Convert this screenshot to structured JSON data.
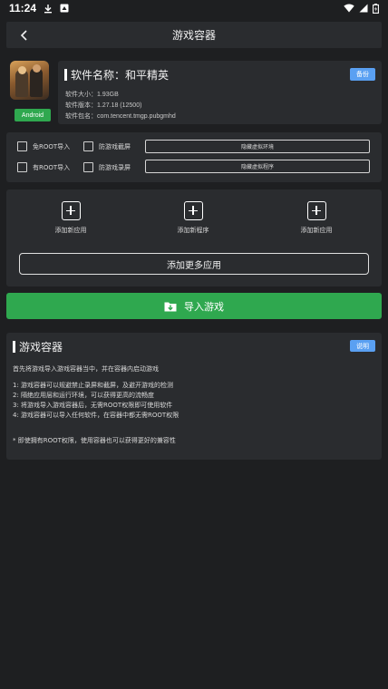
{
  "status": {
    "time": "11:24",
    "left_icons": [
      "download-icon",
      "notification-box-icon"
    ],
    "right_icons": [
      "wifi-icon",
      "signal-icon",
      "battery-icon"
    ]
  },
  "header": {
    "title": "游戏容器",
    "back_icon": "chevron-left-icon"
  },
  "app": {
    "platform": "Android",
    "name": "软件名称：和平精英",
    "backup_label": "备份",
    "size": "软件大小：1.93GB",
    "version": "软件版本：1.27.18 (12500)",
    "package": "软件包名：com.tencent.tmgp.pubgmhd"
  },
  "options": {
    "noroot_import": "免ROOT导入",
    "root_import": "有ROOT导入",
    "anti_screenshot": "防游戏截屏",
    "anti_record": "防游戏录屏",
    "btn1": "隐藏虚拟环境",
    "btn2": "隐藏虚拟程序"
  },
  "add": {
    "items": [
      "添加新应用",
      "添加新程序",
      "添加新应用"
    ],
    "more_label": "添加更多应用"
  },
  "import": {
    "label": "导入游戏",
    "icon": "folder-import-icon"
  },
  "desc": {
    "title": "游戏容器",
    "explain_label": "说明",
    "intro": "首先将游戏导入游戏容器当中，并在容器内启动游戏",
    "points": [
      "1:  游戏容器可以规避禁止录屏和截屏，及避开游戏的检测",
      "2:  隔绝应用层和运行环境，可以获得更高的流畅度",
      "3:  将游戏导入游戏容器后，无需ROOT权限即可使用软件",
      "4:  游戏容器可以导入任何软件，在容器中都无需ROOT权限"
    ],
    "note": "* 即使拥有ROOT权限，使用容器也可以获得更好的兼容性"
  }
}
